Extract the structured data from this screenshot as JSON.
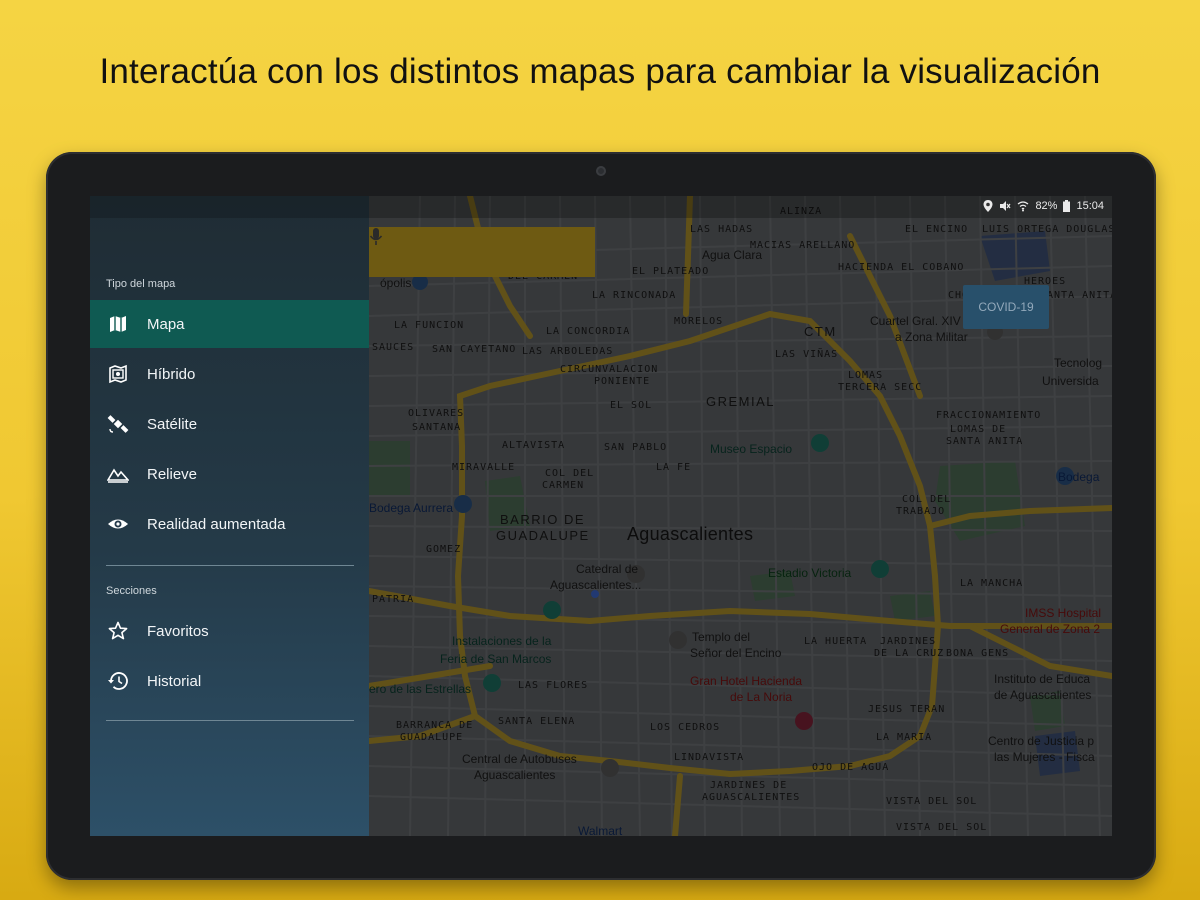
{
  "headline": "Interactúa con los distintos mapas para cambiar la visualización",
  "status": {
    "battery": "82%",
    "time": "15:04"
  },
  "covid_button": "COVID-19",
  "drawer": {
    "section_map_type": "Tipo del mapa",
    "map_types": [
      {
        "label": "Mapa",
        "icon": "map-icon",
        "active": true
      },
      {
        "label": "Híbrido",
        "icon": "hybrid-map-icon",
        "active": false
      },
      {
        "label": "Satélite",
        "icon": "satellite-icon",
        "active": false
      },
      {
        "label": "Relieve",
        "icon": "terrain-icon",
        "active": false
      },
      {
        "label": "Realidad aumentada",
        "icon": "augmented-reality-icon",
        "active": false
      }
    ],
    "section_sections": "Secciones",
    "sections": [
      {
        "label": "Favoritos",
        "icon": "star-icon"
      },
      {
        "label": "Historial",
        "icon": "history-icon"
      }
    ]
  },
  "map": {
    "city": "Aguascalientes",
    "labels": {
      "alinza": "ALINZA",
      "las_hadas": "LAS HADAS",
      "el_encino": "EL ENCINO",
      "luis_ortega": "LUIS ORTEGA DOUGLAS",
      "macias_arellano": "MACIAS ARELLANO",
      "agua_clara": "Agua Clara",
      "hacienda_cobano": "HACIENDA EL COBANO",
      "el_plateado": "EL PLATEADO",
      "del_carmen": "DEL CARMEN",
      "la_rinconada": "LA RINCONADA",
      "chop_del": "CHOP DEL",
      "heroes": "HEROES",
      "santa_anita": "SANTA ANITA",
      "ta_santa": "TA SANTA",
      "morelos": "MORELOS",
      "ctm": "CTM",
      "cuartel": "Cuartel Gral. XIV",
      "zona_militar": "a Zona Militar",
      "la_funcion": "LA FUNCION",
      "la_concordia": "LA CONCORDIA",
      "las_vinas": "LAS VIÑAS",
      "san_cayetano": "SAN CAYETANO",
      "las_arboledas": "LAS ARBOLEDAS",
      "tecnologico": "Tecnolog",
      "universidad": "Universida",
      "sauces": "SAUCES",
      "circunvalacion": "CIRCUNVALACION",
      "poniente": "PONIENTE",
      "lomas": "LOMAS",
      "tercera": "TERCERA SECC",
      "el_sol": "EL SOL",
      "gremial": "GREMIAL",
      "olivares": "OLIVARES",
      "santana": "SANTANA",
      "fraccionamiento": "FRACCIONAMIENTO",
      "lomas_santa": "LOMAS DE",
      "santa_anita2": "SANTA ANITA",
      "altavista": "ALTAVISTA",
      "san_pablo": "SAN PABLO",
      "museo": "Museo Espacio",
      "miravalle": "MIRAVALLE",
      "la_fe": "LA FE",
      "col_carmen": "COL DEL",
      "carmen": "CARMEN",
      "bodega": "Bodega",
      "bodega_aurrera": "Bodega Aurrera",
      "barrio": "BARRIO DE",
      "guadalupe": "GUADALUPE",
      "col_trabajo": "COL DEL",
      "trabajo": "TRABAJO",
      "gomez": "GOMEZ",
      "catedral": "Catedral de",
      "catedral2": "Aguascalientes...",
      "estadio": "Estadio Victoria",
      "la_mancha": "LA MANCHA",
      "patria": "PATRIA",
      "imss": "IMSS Hospital",
      "imss2": "General de Zona 2",
      "instalaciones": "Instalaciones de la",
      "feria": "Feria de San Marcos",
      "templo": "Templo del",
      "senor": "Señor del Encino",
      "la_huerta": "LA HUERTA",
      "jardines": "JARDINES",
      "de_la_cruz": "DE LA CRUZ",
      "bona_gens": "BONA GENS",
      "instituto": "Instituto de Educa",
      "instituto2": "de Aguascalientes",
      "las_flores": "LAS FLORES",
      "gran_hotel": "Gran Hotel Hacienda",
      "la_noria": "de La Noria",
      "estrellas": "ero de las Estrellas",
      "barranca": "BARRANCA DE",
      "guadalupe2": "GUADALUPE",
      "santa_elena": "SANTA ELENA",
      "jesus_teran": "JESUS TERAN",
      "los_cedros": "LOS CEDROS",
      "la_maria": "LA MARIA",
      "centro_justicia": "Centro de Justicia p",
      "las_mujeres": "las Mujeres - Fisca",
      "central": "Central de Autobuses",
      "central2": "Aguascalientes",
      "lindavista": "LINDAVISTA",
      "ojo_agua": "OJO DE AGUA",
      "jardines_aguas": "JARDINES DE",
      "aguascalientes_lbl": "AGUASCALIENTES",
      "vista_sol": "VISTA DEL SOL",
      "walmart": "Walmart",
      "metropolis": "ópolis",
      "vista_sol2": "VISTA DEL SOL"
    }
  }
}
